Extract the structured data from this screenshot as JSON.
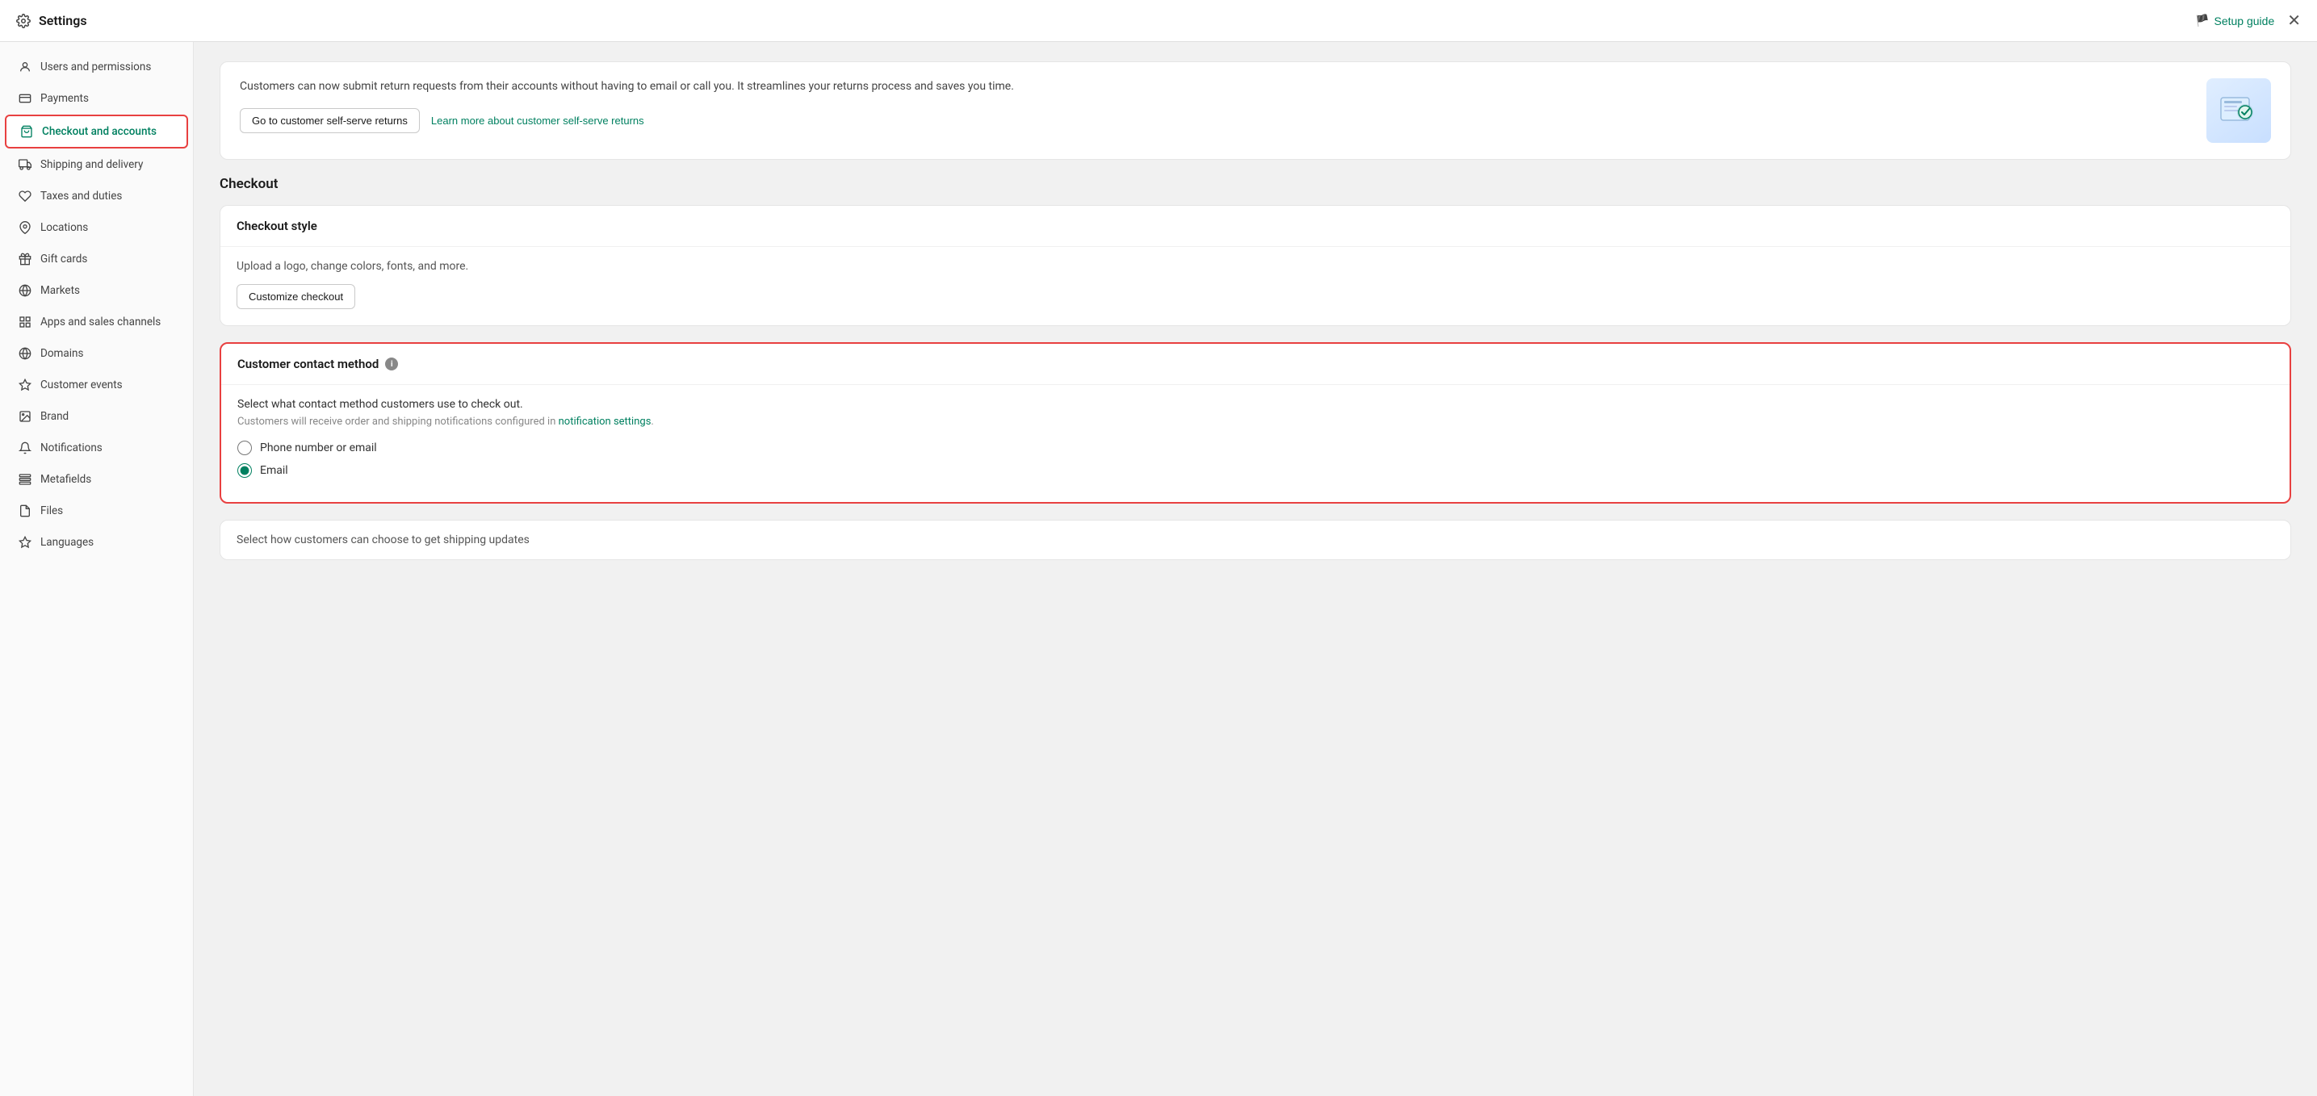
{
  "header": {
    "title": "Settings",
    "setup_guide_label": "Setup guide",
    "close_label": "✕"
  },
  "sidebar": {
    "items": [
      {
        "id": "users",
        "label": "Users and permissions",
        "icon": "👤"
      },
      {
        "id": "payments",
        "label": "Payments",
        "icon": "💳"
      },
      {
        "id": "checkout",
        "label": "Checkout and accounts",
        "icon": "🛒",
        "active": true
      },
      {
        "id": "shipping",
        "label": "Shipping and delivery",
        "icon": "🚚"
      },
      {
        "id": "taxes",
        "label": "Taxes and duties",
        "icon": "🏷"
      },
      {
        "id": "locations",
        "label": "Locations",
        "icon": "📍"
      },
      {
        "id": "giftcards",
        "label": "Gift cards",
        "icon": "🎁"
      },
      {
        "id": "markets",
        "label": "Markets",
        "icon": "🌐"
      },
      {
        "id": "apps",
        "label": "Apps and sales channels",
        "icon": "⊞"
      },
      {
        "id": "domains",
        "label": "Domains",
        "icon": "🌐"
      },
      {
        "id": "customer-events",
        "label": "Customer events",
        "icon": "✦"
      },
      {
        "id": "brand",
        "label": "Brand",
        "icon": "🖼"
      },
      {
        "id": "notifications",
        "label": "Notifications",
        "icon": "🔔"
      },
      {
        "id": "metafields",
        "label": "Metafields",
        "icon": "⊟"
      },
      {
        "id": "files",
        "label": "Files",
        "icon": "📎"
      },
      {
        "id": "languages",
        "label": "Languages",
        "icon": "✦"
      }
    ]
  },
  "main": {
    "returns_card": {
      "text": "Customers can now submit return requests from their accounts without having to email or call you. It streamlines your returns process and saves you time.",
      "btn_primary": "Go to customer self-serve returns",
      "btn_link": "Learn more about customer self-serve returns"
    },
    "section_title": "Checkout",
    "checkout_style": {
      "heading": "Checkout style",
      "description": "Upload a logo, change colors, fonts, and more.",
      "btn_customize": "Customize checkout"
    },
    "contact_method": {
      "heading": "Customer contact method",
      "info_icon": "i",
      "description": "Select what contact method customers use to check out.",
      "note_prefix": "Customers will receive order and shipping notifications configured in ",
      "note_link_text": "notification settings",
      "note_suffix": ".",
      "options": [
        {
          "id": "phone-email",
          "label": "Phone number or email",
          "checked": false
        },
        {
          "id": "email",
          "label": "Email",
          "checked": true
        }
      ]
    },
    "footer_card": {
      "text": "Select how customers can choose to get shipping updates"
    }
  }
}
